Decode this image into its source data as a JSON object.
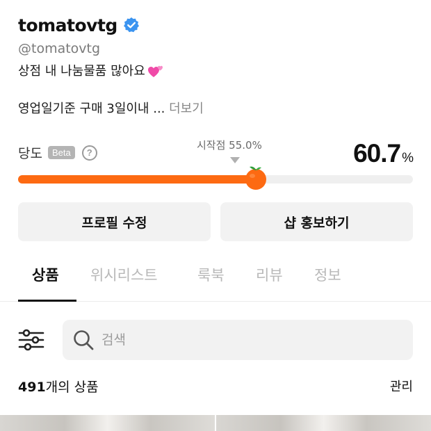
{
  "profile": {
    "username": "tomatovtg",
    "handle": "@tomatovtg",
    "bio": "상점 내 나눔물품 많아요",
    "description": "영업일기준 구매 3일이내 ...",
    "more_label": "더보기"
  },
  "temperature": {
    "label": "당도",
    "beta_label": "Beta",
    "help_label": "?",
    "start_label": "시작점 55.0%",
    "value": 60.7,
    "value_text": "60.7",
    "unit": "%",
    "fill_color": "#fd6a12"
  },
  "buttons": {
    "edit_profile": "프로필 수정",
    "promote_shop": "샵 홍보하기"
  },
  "tabs": [
    "상품",
    "위시리스트",
    "룩북",
    "리뷰",
    "정보"
  ],
  "active_tab": 0,
  "search": {
    "placeholder": "검색",
    "filter_icon": "sliders-icon",
    "search_icon": "search-icon"
  },
  "products": {
    "count": "491",
    "count_suffix": "개의 상품",
    "manage_label": "관리"
  },
  "colors": {
    "accent": "#fd6a12",
    "verified": "#3b94f0"
  }
}
